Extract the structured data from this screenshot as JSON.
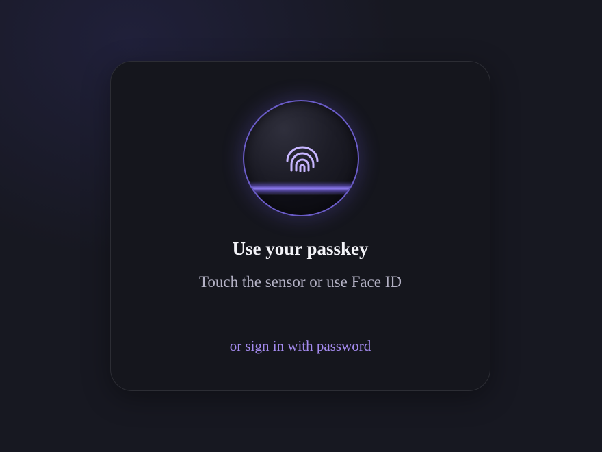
{
  "card": {
    "title": "Use your passkey",
    "subtitle": "Touch the sensor or use Face ID",
    "alt_sign_in_label": "or sign in with password"
  },
  "sensor": {
    "icon": "fingerprint-icon"
  },
  "colors": {
    "background": "#171821",
    "card": "#15161d",
    "accent": "#a58bf0",
    "sensor_ring": "#6a5cc7",
    "title": "#f3f3f8",
    "subtitle": "#b3b1c4"
  }
}
